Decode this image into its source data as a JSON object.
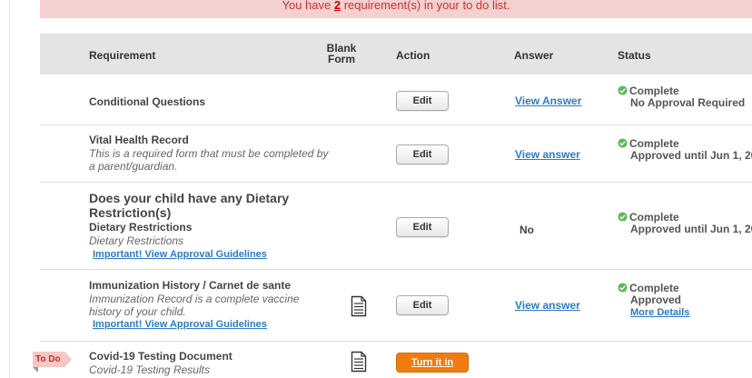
{
  "banner": {
    "prefix": "You have ",
    "count": "2",
    "suffix": " requirement(s) in your to do list."
  },
  "columns": {
    "requirement": "Requirement",
    "blank_form": "Blank Form",
    "action": "Action",
    "answer": "Answer",
    "status": "Status"
  },
  "rows": [
    {
      "title": "Conditional Questions",
      "button": "Edit",
      "answer": "View Answer",
      "status_line1": "Complete",
      "status_line2": "No Approval Required"
    },
    {
      "title": "Vital Health Record",
      "desc": "This is a required form that must be completed by a parent/guardian.",
      "button": "Edit",
      "answer": "View answer",
      "status_line1": "Complete",
      "status_line2": "Approved until Jun 1, 20"
    },
    {
      "title": "Does your child have any Dietary Restriction(s)",
      "subtitle": "Dietary Restrictions",
      "desc": "Dietary Restrictions",
      "guideline": "Important! View Approval Guidelines",
      "button": "Edit",
      "answer": "No",
      "status_line1": "Complete",
      "status_line2": "Approved until Jun 1, 20"
    },
    {
      "title": "Immunization History / Carnet de sante",
      "desc": "Immunization Record is a complete vaccine history of your child.",
      "guideline": "Important! View Approval Guidelines",
      "button": "Edit",
      "answer": "View answer",
      "status_line1": "Complete",
      "status_line2": "Approved",
      "status_link": "More Details"
    },
    {
      "badge": "To Do",
      "title": "Covid-19 Testing Document",
      "desc": "Covid-19 Testing Results",
      "button": "Turn it in"
    }
  ],
  "colors": {
    "banner_bg": "#f4d0d0",
    "header_bg": "#e4e4e4",
    "link": "#2e7bc4",
    "complete_green": "#5cb85c",
    "turn_in_orange": "#f07b11"
  },
  "icons": [
    "check-circle-icon",
    "blank-form-icon"
  ]
}
